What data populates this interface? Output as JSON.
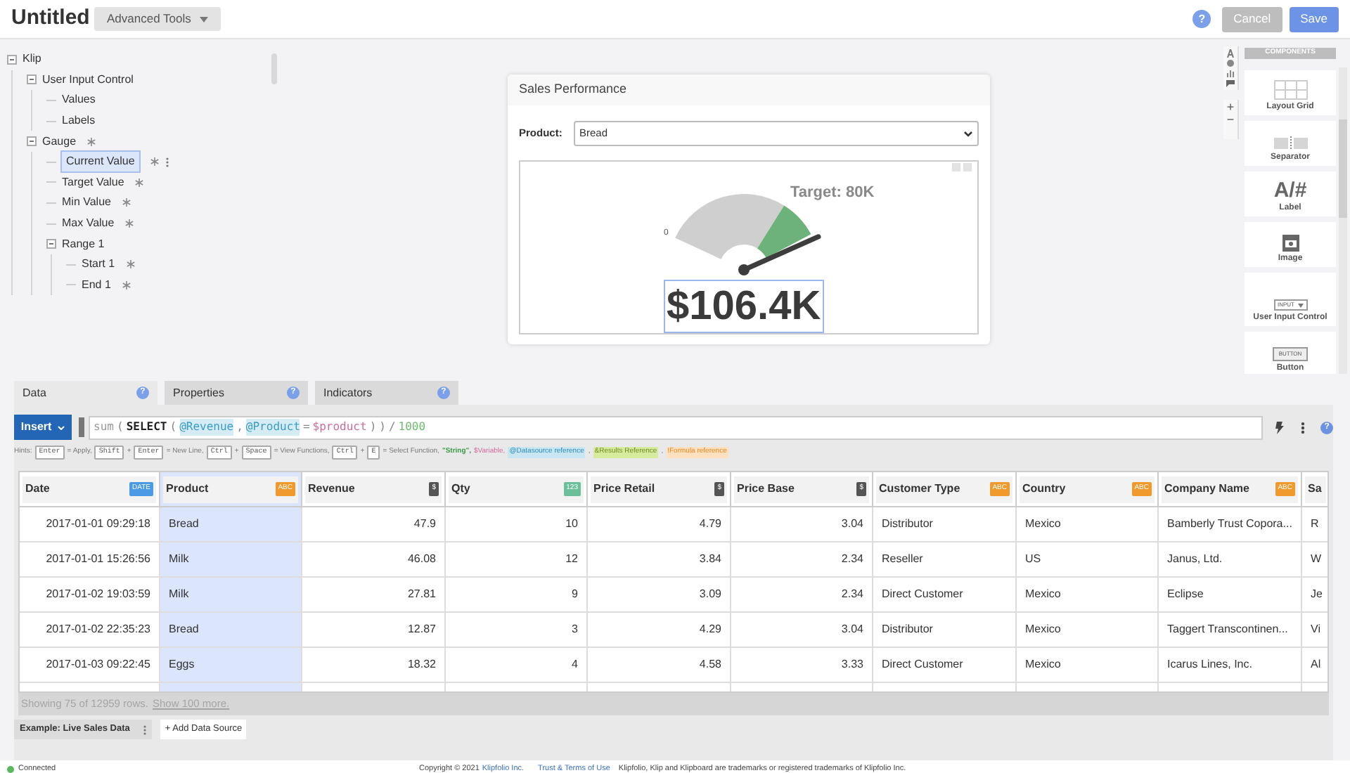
{
  "header": {
    "title": "Untitled",
    "tools_menu": "Advanced Tools",
    "help": "?",
    "buttons": [
      {
        "label": "Cancel",
        "kind": "secondary"
      },
      {
        "label": "Save",
        "kind": "primary"
      }
    ]
  },
  "tree": [
    {
      "label": "Klip",
      "required": false,
      "selected": false,
      "expanded": true,
      "children": [
        {
          "label": "User Input Control",
          "required": false,
          "selected": false,
          "expanded": true,
          "children": [
            {
              "label": "Values",
              "required": false,
              "selected": false
            },
            {
              "label": "Labels",
              "required": false,
              "selected": false
            }
          ]
        },
        {
          "label": "Gauge",
          "required": true,
          "selected": false,
          "expanded": true,
          "children": [
            {
              "label": "Current Value",
              "required": true,
              "selected": true
            },
            {
              "label": "Target Value",
              "required": true,
              "selected": false
            },
            {
              "label": "Min Value",
              "required": true,
              "selected": false
            },
            {
              "label": "Max Value",
              "required": true,
              "selected": false
            },
            {
              "label": "Range 1",
              "required": false,
              "selected": false,
              "expanded": true,
              "children": [
                {
                  "label": "Start 1",
                  "required": true,
                  "selected": false
                },
                {
                  "label": "End 1",
                  "required": true,
                  "selected": false
                }
              ]
            }
          ]
        }
      ]
    }
  ],
  "klip": {
    "title": "Sales Performance",
    "filter_label": "Product:",
    "filter_value": "Bread",
    "gauge": {
      "min_label": "0",
      "target_label": "Target: 80K",
      "value": "$106.4K"
    }
  },
  "side_tools": [
    "+",
    "−"
  ],
  "components": {
    "title": "COMPONENTS",
    "items": [
      {
        "label": "Layout Grid",
        "kind": "grid"
      },
      {
        "label": "Separator",
        "kind": "separator"
      },
      {
        "label": "Label",
        "kind": "label",
        "icon_text": "A/#"
      },
      {
        "label": "Image",
        "kind": "image"
      },
      {
        "label": "User Input Control",
        "kind": "input",
        "icon_text": "INPUT"
      },
      {
        "label": "Button",
        "kind": "button",
        "icon_text": "BUTTON"
      }
    ]
  },
  "tabs": [
    {
      "label": "Data",
      "selected": true
    },
    {
      "label": "Properties",
      "selected": false
    },
    {
      "label": "Indicators",
      "selected": false
    }
  ],
  "formula": {
    "insert": "Insert",
    "tokens": [
      {
        "text": "sum",
        "kind": "func"
      },
      {
        "text": "(",
        "kind": "punct"
      },
      {
        "text": "SELECT",
        "kind": "keyword"
      },
      {
        "text": "(",
        "kind": "punct"
      },
      {
        "text": "@Revenue",
        "kind": "datasource"
      },
      {
        "text": ",",
        "kind": "punct"
      },
      {
        "text": "@Product",
        "kind": "datasource"
      },
      {
        "text": "=",
        "kind": "punct"
      },
      {
        "text": "$product",
        "kind": "variable"
      },
      {
        "text": ")",
        "kind": "punct"
      },
      {
        "text": ")",
        "kind": "punct"
      },
      {
        "text": "/",
        "kind": "punct"
      },
      {
        "text": "1000",
        "kind": "number"
      }
    ]
  },
  "hints": [
    {
      "text": "Hints:",
      "kind": "text"
    },
    {
      "text": "Enter",
      "kind": "key"
    },
    {
      "text": "= Apply,",
      "kind": "text"
    },
    {
      "text": "Shift",
      "kind": "key"
    },
    {
      "text": "+",
      "kind": "text"
    },
    {
      "text": "Enter",
      "kind": "key"
    },
    {
      "text": "= New Line,",
      "kind": "text"
    },
    {
      "text": "Ctrl",
      "kind": "key"
    },
    {
      "text": "+",
      "kind": "text"
    },
    {
      "text": "Space",
      "kind": "key"
    },
    {
      "text": "= View Functions,",
      "kind": "text"
    },
    {
      "text": "Ctrl",
      "kind": "key"
    },
    {
      "text": "+",
      "kind": "text"
    },
    {
      "text": "E",
      "kind": "key"
    },
    {
      "text": "= Select Function,",
      "kind": "text"
    },
    {
      "text": "\"String\",",
      "kind": "string"
    },
    {
      "text": "$Variable,",
      "kind": "variable"
    },
    {
      "text": "@Datasource reference",
      "kind": "datasource"
    },
    {
      "text": ",",
      "kind": "text"
    },
    {
      "text": "&Results Reference",
      "kind": "results"
    },
    {
      "text": ",",
      "kind": "text"
    },
    {
      "text": "!Formula reference",
      "kind": "formula"
    }
  ],
  "table": {
    "columns": [
      {
        "label": "Date",
        "badge": "DATE",
        "kind": "date",
        "selected": false
      },
      {
        "label": "Product",
        "badge": "ABC",
        "kind": "text",
        "selected": true
      },
      {
        "label": "Revenue",
        "badge": "$",
        "kind": "currency",
        "selected": false
      },
      {
        "label": "Qty",
        "badge": "123",
        "kind": "number",
        "selected": false
      },
      {
        "label": "Price Retail",
        "badge": "$",
        "kind": "currency",
        "selected": false
      },
      {
        "label": "Price Base",
        "badge": "$",
        "kind": "currency",
        "selected": false
      },
      {
        "label": "Customer Type",
        "badge": "ABC",
        "kind": "text",
        "selected": false
      },
      {
        "label": "Country",
        "badge": "ABC",
        "kind": "text",
        "selected": false
      },
      {
        "label": "Company Name",
        "badge": "ABC",
        "kind": "text",
        "selected": false
      },
      {
        "label": "Sa",
        "kind": "text",
        "selected": false
      }
    ],
    "rows": [
      [
        "2017-01-01 09:29:18",
        "Bread",
        "47.9",
        "10",
        "4.79",
        "3.04",
        "Distributor",
        "Mexico",
        "Bamberly Trust Copora...",
        "R"
      ],
      [
        "2017-01-01 15:26:56",
        "Milk",
        "46.08",
        "12",
        "3.84",
        "2.34",
        "Reseller",
        "US",
        "Janus, Ltd.",
        "W"
      ],
      [
        "2017-01-02 19:03:59",
        "Milk",
        "27.81",
        "9",
        "3.09",
        "2.34",
        "Direct Customer",
        "Mexico",
        "Eclipse",
        "Je"
      ],
      [
        "2017-01-02 22:35:23",
        "Bread",
        "12.87",
        "3",
        "4.29",
        "3.04",
        "Distributor",
        "Mexico",
        "Taggert Transcontinen...",
        "Vi"
      ],
      [
        "2017-01-03 09:22:45",
        "Eggs",
        "18.32",
        "4",
        "4.58",
        "3.33",
        "Direct Customer",
        "Mexico",
        "Icarus Lines, Inc.",
        "Al"
      ]
    ],
    "summary": "Showing 75 of 12959 rows.",
    "more_link": "Show 100 more."
  },
  "sources": {
    "tabs": [
      {
        "label": "Example: Live Sales Data",
        "selected": true
      }
    ],
    "add": "+ Add Data Source"
  },
  "footer": {
    "status": "Connected",
    "connected": true,
    "copyright": "Copyright © 2021",
    "company_link": "Klipfolio Inc.",
    "terms_link": "Trust & Terms of Use",
    "trademark": "Klipfolio, Klip and Klipboard are trademarks or registered trademarks of Klipfolio Inc."
  }
}
